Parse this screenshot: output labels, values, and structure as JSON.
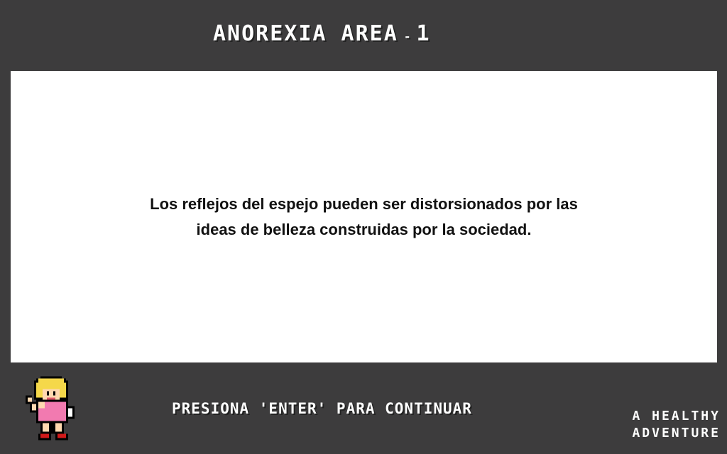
{
  "header": {
    "area_name": "ANOREXIA AREA",
    "separator": "-",
    "level": "1"
  },
  "dialog": {
    "lines": [
      "Los reflejos del espejo pueden ser distorsionados por las",
      "ideas de belleza construidas por la sociedad."
    ]
  },
  "footer": {
    "prompt": "PRESIONA 'ENTER' PARA CONTINUAR",
    "brand_line1": "A HEALTHY",
    "brand_line2": "ADVENTURE"
  },
  "character": {
    "icon": "pixel-girl-waving-icon",
    "hair_color": "#f5d84a",
    "shirt_color": "#f27ab0",
    "shoe_color": "#d11a1a"
  }
}
